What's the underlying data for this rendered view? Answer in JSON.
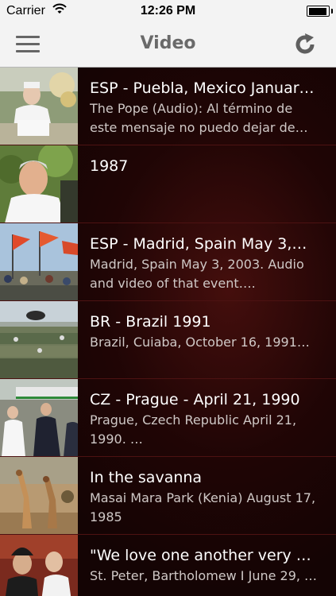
{
  "status_bar": {
    "carrier": "Carrier",
    "time": "12:26 PM",
    "battery_level": 0.95
  },
  "nav": {
    "title": "Video",
    "menu_icon": "hamburger-menu-icon",
    "refresh_icon": "refresh-icon"
  },
  "videos": [
    {
      "title": "ESP - Puebla, Mexico January…",
      "description": "The Pope (Audio): Al término de este mensaje no puedo dejar de…"
    },
    {
      "title": "1987",
      "description": ""
    },
    {
      "title": "ESP - Madrid, Spain May 3,…",
      "description": "Madrid, Spain May 3, 2003. Audio and video of that event…."
    },
    {
      "title": "BR - Brazil 1991",
      "description": "Brazil, Cuiaba, October 16, 1991…"
    },
    {
      "title": "CZ - Prague - April 21, 1990",
      "description": "Prague, Czech Republic April 21, 1990. …"
    },
    {
      "title": "In the savanna",
      "description": "Masai Mara Park (Kenia) August 17, 1985"
    },
    {
      "title": "\"We love one another very m…",
      "description": "St. Peter, Bartholomew I    June 29, …"
    }
  ]
}
